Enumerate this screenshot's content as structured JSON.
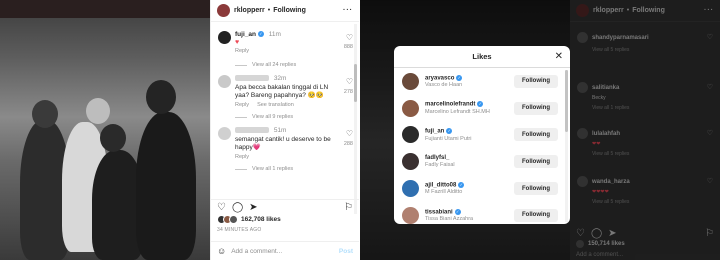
{
  "left": {
    "header": {
      "username": "rklopperr",
      "separator": "•",
      "follow_label": "Following",
      "more": "···"
    },
    "comments": [
      {
        "user": "fuji_an",
        "time": "11m",
        "text": "♥",
        "likes": "888",
        "reply": "Reply",
        "view_replies": "View all 24 replies"
      },
      {
        "user": "",
        "time": "32m",
        "text": "Apa becca bakalan tinggal di LN yaa? Bareng papahnya? 🥺🥺",
        "likes": "278",
        "reply": "Reply",
        "translate": "See translation",
        "view_replies": "View all 9 replies"
      },
      {
        "user": "",
        "time": "51m",
        "text": "semangat cantik! u deserve to be happy💗",
        "likes": "288",
        "reply": "Reply",
        "view_replies": "View all 1 replies"
      }
    ],
    "likes_count": "162,708 likes",
    "time_ago": "34 MINUTES AGO",
    "add_comment_placeholder": "Add a comment...",
    "post_label": "Post"
  },
  "right": {
    "header": {
      "username": "rklopperr",
      "separator": "•",
      "follow_label": "Following",
      "more": "···"
    },
    "comments": [
      {
        "user": "shandyparnamasari",
        "heart": "♡",
        "view": "View all 5 replies"
      },
      {
        "user": "salitianka",
        "text": "Becky",
        "heart": "♡",
        "view": "View all 1 replies"
      },
      {
        "user": "lulalahfah",
        "text": "❤❤",
        "heart": "♡",
        "view": "View all 5 replies"
      },
      {
        "user": "wanda_harza",
        "text": "❤❤❤❤",
        "heart": "♡",
        "view": "View all 5 replies"
      }
    ],
    "likes_count": "150,714 likes",
    "add_comment_placeholder": "Add a comment...",
    "modal": {
      "title": "Likes",
      "close": "✕",
      "users": [
        {
          "username": "aryavasco",
          "fullname": "Vasco de Haan",
          "button": "Following",
          "color": "#6a4a3a"
        },
        {
          "username": "marcelinolefrandt",
          "fullname": "Marcelino Lefrandt SH.MH",
          "button": "Following",
          "color": "#8a5a44"
        },
        {
          "username": "fuji_an",
          "fullname": "Fujianti Utami Putri",
          "button": "Following",
          "color": "#2a2a2a"
        },
        {
          "username": "fadlyfsl_",
          "fullname": "Fadly Faisal",
          "button": "Following",
          "color": "#3a3030"
        },
        {
          "username": "ajil_ditto08",
          "fullname": "M Fazrill Alditto",
          "button": "Following",
          "color": "#2f6fb0"
        },
        {
          "username": "tissabiani",
          "fullname": "Tissa Biani Azzahra",
          "button": "Following",
          "color": "#b08070"
        }
      ]
    }
  }
}
